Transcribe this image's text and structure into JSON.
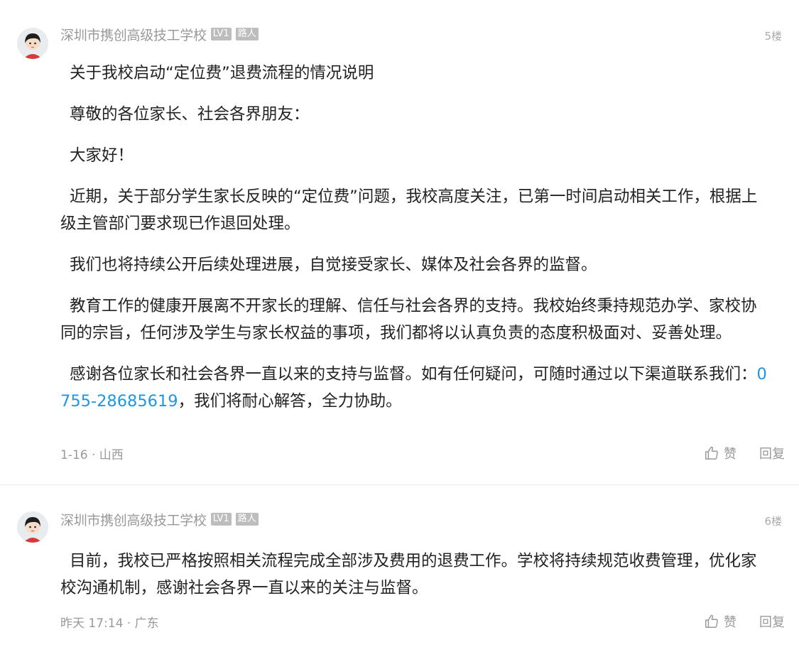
{
  "posts": [
    {
      "user": {
        "name": "深圳市携创高级技工学校",
        "level": "LV1",
        "tag": "路人"
      },
      "floor": "5楼",
      "paragraphs": [
        "关于我校启动“定位费”退费流程的情况说明",
        "尊敬的各位家长、社会各界朋友：",
        "大家好！",
        "近期，关于部分学生家长反映的“定位费”问题，我校高度关注，已第一时间启动相关工作，根据上级主管部门要求现已作退回处理。",
        "我们也将持续公开后续处理进展，自觉接受家长、媒体及社会各界的监督。",
        "教育工作的健康开展离不开家长的理解、信任与社会各界的支持。我校始终秉持规范办学、家校协同的宗旨，任何涉及学生与家长权益的事项，我们都将以认真负责的态度积极面对、妥善处理。"
      ],
      "last_paragraph": {
        "before": "感谢各位家长和社会各界一直以来的支持与监督。如有任何疑问，可随时通过以下渠道联系我们：",
        "phone": "0755-28685619",
        "after": "，我们将耐心解答，全力协助。"
      },
      "meta": "1-16 · 山西",
      "like_label": "赞",
      "reply_label": "回复"
    },
    {
      "user": {
        "name": "深圳市携创高级技工学校",
        "level": "LV1",
        "tag": "路人"
      },
      "floor": "6楼",
      "paragraphs": [
        "目前，我校已严格按照相关流程完成全部涉及费用的退费工作。学校将持续规范收费管理，优化家校沟通机制，感谢社会各界一直以来的关注与监督。"
      ],
      "meta": "昨天 17:14 · 广东",
      "like_label": "赞",
      "reply_label": "回复"
    }
  ],
  "icons": {
    "like": "thumbs-up-icon",
    "avatar": "cartoon-avatar"
  },
  "colors": {
    "link": "#1f96e4",
    "meta": "#999999",
    "badge": "#bdbdbd"
  }
}
